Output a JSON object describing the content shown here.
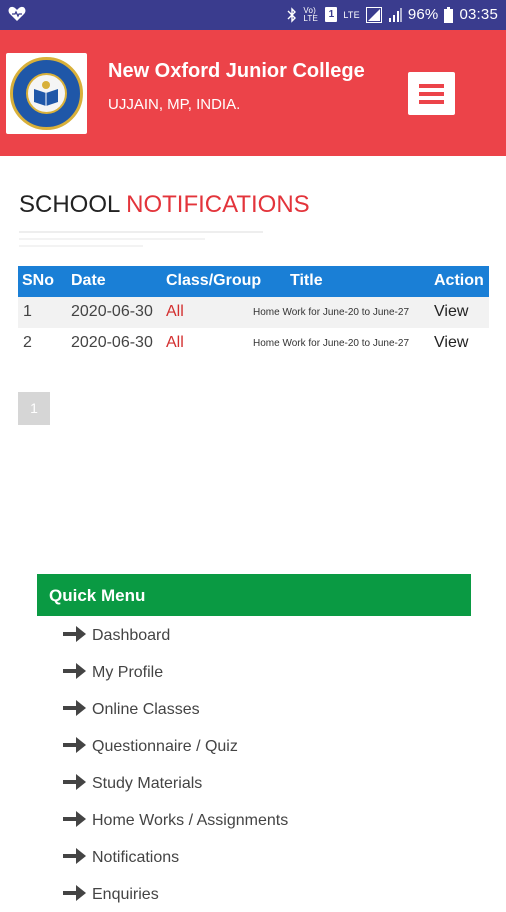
{
  "statusbar": {
    "volte": "Vo) LTE",
    "sim": "1",
    "lte": "LTE",
    "battery": "96%",
    "time": "03:35"
  },
  "header": {
    "college_name": "New Oxford Junior College",
    "location": "UJJAIN, MP, INDIA.",
    "logo_text": "NEW OXFORD JUNIOR COLLEGE UJJAIN"
  },
  "page": {
    "title_plain": "SCHOOL",
    "title_accent": "NOTIFICATIONS"
  },
  "table": {
    "headers": [
      "SNo",
      "Date",
      "Class/Group",
      "Title",
      "Action"
    ],
    "rows": [
      {
        "sno": "1",
        "date": "2020-06-30",
        "group": "All",
        "title": "Home Work for June-20 to June-27",
        "action": "View"
      },
      {
        "sno": "2",
        "date": "2020-06-30",
        "group": "All",
        "title": "Home Work for June-20 to June-27",
        "action": "View"
      }
    ]
  },
  "pagination": {
    "current": "1"
  },
  "quick_menu": {
    "title": "Quick Menu",
    "items": [
      "Dashboard",
      "My Profile",
      "Online Classes",
      "Questionnaire / Quiz",
      "Study Materials",
      "Home Works / Assignments",
      "Notifications",
      "Enquiries"
    ]
  },
  "colors": {
    "statusbar": "#3a3c8e",
    "header": "#ec4349",
    "table_header": "#1a7fd6",
    "quick_menu_header": "#0a9a43",
    "accent_red": "#e3343b"
  }
}
